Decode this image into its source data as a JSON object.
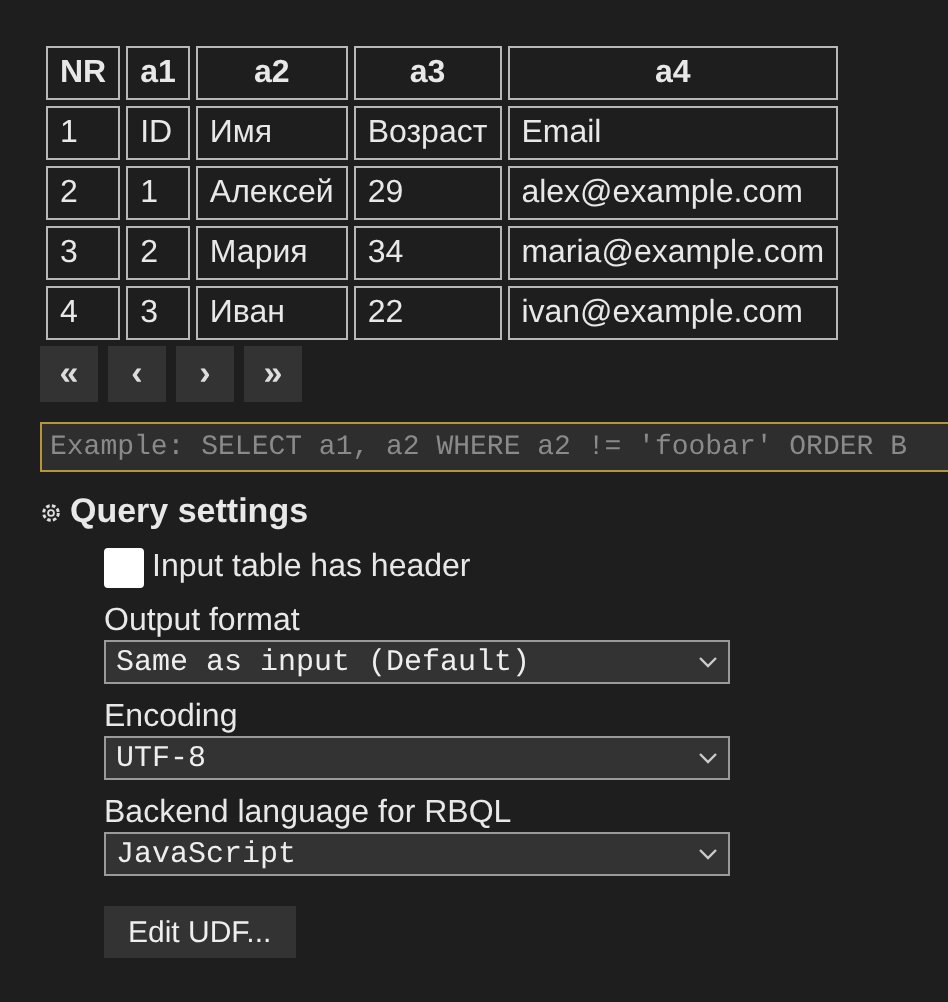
{
  "table": {
    "columns": [
      "NR",
      "a1",
      "a2",
      "a3",
      "a4"
    ],
    "rows": [
      [
        "1",
        "ID",
        "Имя",
        "Возраст",
        "Email"
      ],
      [
        "2",
        "1",
        "Алексей",
        "29",
        "alex@example.com"
      ],
      [
        "3",
        "2",
        "Мария",
        "34",
        "maria@example.com"
      ],
      [
        "4",
        "3",
        "Иван",
        "22",
        "ivan@example.com"
      ]
    ]
  },
  "pager": [
    "«",
    "‹",
    "›",
    "»"
  ],
  "query": {
    "placeholder": "Example: SELECT a1, a2 WHERE a2 != 'foobar' ORDER B"
  },
  "settings": {
    "title": "Query settings",
    "header_checkbox": {
      "label": "Input table has header",
      "checked": false
    },
    "selects": [
      {
        "label": "Output format",
        "value": "Same as input (Default)"
      },
      {
        "label": "Encoding",
        "value": "UTF-8"
      },
      {
        "label": "Backend language for RBQL",
        "value": "JavaScript"
      }
    ],
    "button": "Edit UDF..."
  }
}
